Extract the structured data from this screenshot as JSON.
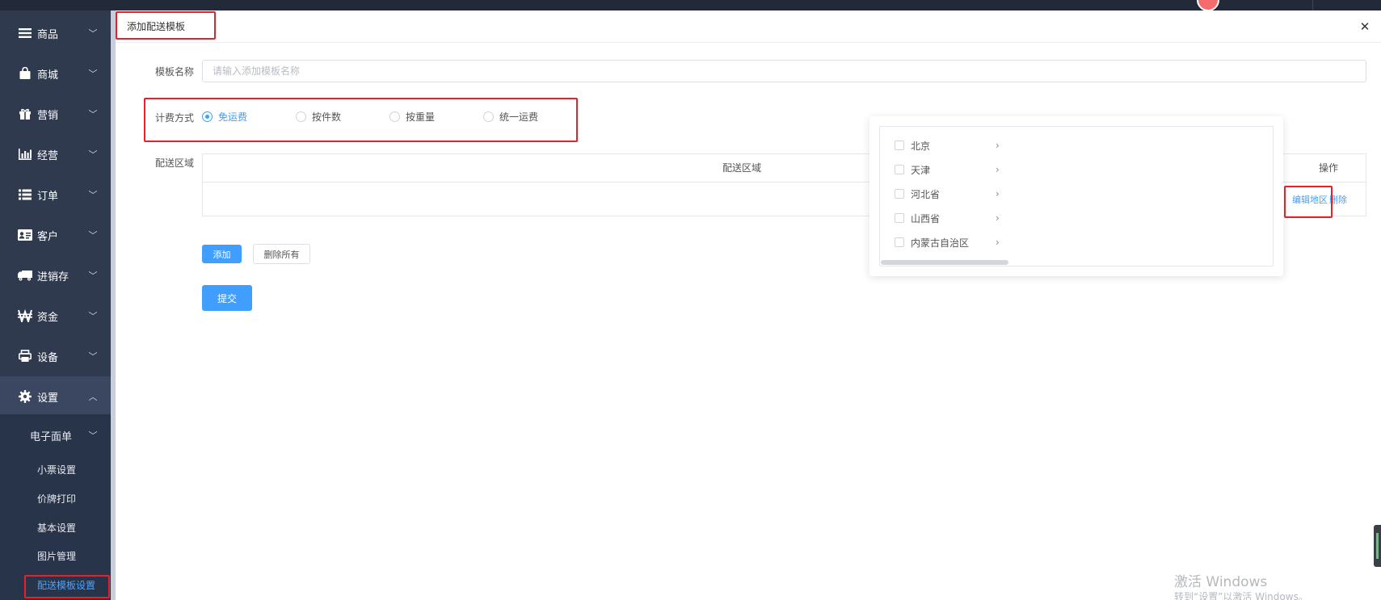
{
  "sidebar": {
    "items": [
      {
        "label": "商品",
        "icon": "menu-lines-icon",
        "chevron": "﹀"
      },
      {
        "label": "商城",
        "icon": "shopping-bag-icon",
        "chevron": "﹀"
      },
      {
        "label": "营销",
        "icon": "gift-icon",
        "chevron": "﹀"
      },
      {
        "label": "经营",
        "icon": "bar-chart-icon",
        "chevron": "﹀"
      },
      {
        "label": "订单",
        "icon": "list-icon",
        "chevron": "﹀"
      },
      {
        "label": "客户",
        "icon": "id-card-icon",
        "chevron": "﹀"
      },
      {
        "label": "进销存",
        "icon": "truck-icon",
        "chevron": "﹀"
      },
      {
        "label": "资金",
        "icon": "won-currency-icon",
        "chevron": "﹀"
      },
      {
        "label": "设备",
        "icon": "printer-icon",
        "chevron": "﹀"
      },
      {
        "label": "设置",
        "icon": "gear-icon",
        "chevron": "︿"
      }
    ],
    "submenu": {
      "group_label": "电子面单",
      "group_chevron": "﹀",
      "items": [
        "小票设置",
        "价牌打印",
        "基本设置",
        "图片管理",
        "配送模板设置"
      ],
      "active_item": "配送模板设置"
    }
  },
  "dialog": {
    "title": "添加配送模板",
    "close_symbol": "✕",
    "name_label": "模板名称",
    "name_placeholder": "请输入添加模板名称",
    "name_value": "",
    "billing_label": "计费方式",
    "billing_options": [
      "免运费",
      "按件数",
      "按重量",
      "统一运费"
    ],
    "billing_selected": "免运费",
    "region_label": "配送区域",
    "table": {
      "columns": [
        "配送区域",
        "操作"
      ],
      "row_actions": [
        "编辑地区",
        "删除"
      ]
    },
    "add_button": "添加",
    "delete_all_button": "删除所有",
    "submit_button": "提交"
  },
  "region_picker": {
    "regions": [
      "北京",
      "天津",
      "河北省",
      "山西省",
      "内蒙古自治区"
    ],
    "arrow": "›"
  },
  "watermark": {
    "line1": "激活 Windows",
    "line2": "转到“设置”以激活 Windows。"
  },
  "colors": {
    "sidebar_bg": "#2f3a4f",
    "primary": "#409eff",
    "highlight": "#e8202a"
  }
}
